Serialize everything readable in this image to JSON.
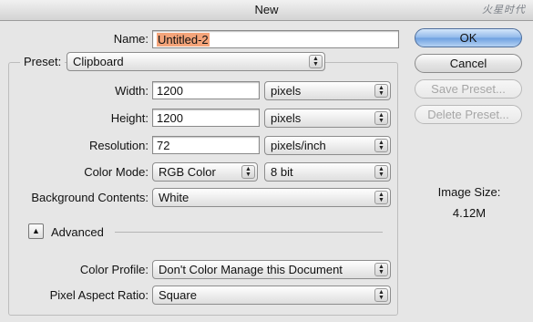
{
  "window": {
    "title": "New",
    "watermark": "火星时代"
  },
  "name": {
    "label": "Name:",
    "value": "Untitled-2"
  },
  "preset": {
    "label": "Preset:",
    "value": "Clipboard"
  },
  "width": {
    "label": "Width:",
    "value": "1200",
    "unit": "pixels"
  },
  "height": {
    "label": "Height:",
    "value": "1200",
    "unit": "pixels"
  },
  "resolution": {
    "label": "Resolution:",
    "value": "72",
    "unit": "pixels/inch"
  },
  "color_mode": {
    "label": "Color Mode:",
    "mode": "RGB Color",
    "depth": "8 bit"
  },
  "background": {
    "label": "Background Contents:",
    "value": "White"
  },
  "advanced": {
    "label": "Advanced",
    "expanded": true
  },
  "color_profile": {
    "label": "Color Profile:",
    "value": "Don't Color Manage this Document"
  },
  "pixel_aspect": {
    "label": "Pixel Aspect Ratio:",
    "value": "Square"
  },
  "buttons": {
    "ok": "OK",
    "cancel": "Cancel",
    "save_preset": "Save Preset...",
    "delete_preset": "Delete Preset..."
  },
  "image_size": {
    "label": "Image Size:",
    "value": "4.12M"
  },
  "colors": {
    "highlight": "#f4a47a",
    "default_button": "#8fb8ea"
  }
}
